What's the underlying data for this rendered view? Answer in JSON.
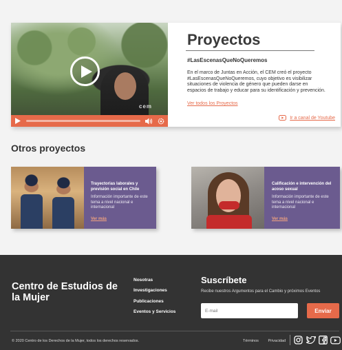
{
  "featured": {
    "title": "Proyectos",
    "hashtag": "#LasEscenasQueNoQueremos",
    "description": "En el marco de Juntas en Acción, el CEM creó el proyecto #LasEscenasQueNoQueremos, cuyo objetivo es visibilizar situaciones de violencia de género que pueden darse en espacios de trabajo y educar para su identificación y prevención.",
    "see_all_link": "Ver todos los Proyectos",
    "youtube_link": "Ir a canal de Youtube",
    "video": {
      "watermark": "cem",
      "progress": 0.0,
      "icons": [
        "play-icon",
        "volume-icon",
        "settings-icon"
      ]
    }
  },
  "others": {
    "title": "Otros proyectos",
    "projects": [
      {
        "title": "Trayectorias laborales y previsión social en Chile",
        "description": "Información importante de este tema a nivel nacional e internacional",
        "link": "Ver más"
      },
      {
        "title": "Calificación e intervención del acoso sexual",
        "description": "Información importante de este tema a nivel nacional e internacional",
        "link": "Ver más"
      }
    ]
  },
  "footer": {
    "brand": "Centro de Estudios de la Mujer",
    "nav": [
      "Nosotras",
      "Investigaciones",
      "Publicaciones",
      "Eventos y Servicios"
    ],
    "subscribe_title": "Suscríbete",
    "subscribe_text": "Recibe nuestros Argumentos para el Cambio y próximos Eventos",
    "email_placeholder": "E-mail",
    "submit_label": "Enviar",
    "copyright": "© 2020 Centro de los Derechos de la Mujer, todos los derechos reservados.",
    "links": [
      "Términos",
      "Privacidad"
    ],
    "social": [
      "instagram-icon",
      "twitter-icon",
      "facebook-icon",
      "youtube-icon"
    ]
  },
  "colors": {
    "accent": "#e66a4a",
    "card_purple": "#6b5b8f",
    "footer_bg": "#333333"
  }
}
